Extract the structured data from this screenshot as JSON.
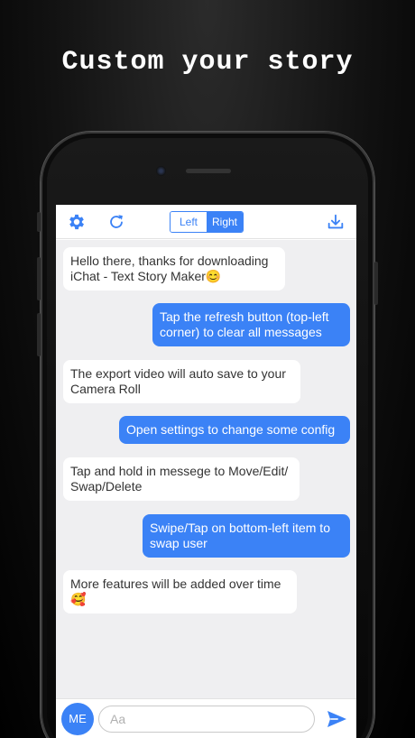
{
  "headline": "Custom your story",
  "toolbar": {
    "settings_icon": "gear-icon",
    "refresh_icon": "refresh-icon",
    "segment": {
      "left_label": "Left",
      "right_label": "Right",
      "selected": "Right"
    },
    "download_icon": "download-icon"
  },
  "messages": [
    {
      "side": "left",
      "text": "Hello there, thanks for downloading iChat - Text Story Maker😊"
    },
    {
      "side": "right",
      "text": "Tap the refresh button (top-left corner) to clear all messages"
    },
    {
      "side": "left",
      "text": "The export video will auto save to your Camera Roll"
    },
    {
      "side": "right",
      "text": "Open settings to change some config"
    },
    {
      "side": "left",
      "text": "Tap and hold in messege to Move/Edit/ Swap/Delete"
    },
    {
      "side": "right",
      "text": "Swipe/Tap on bottom-left item to swap user"
    },
    {
      "side": "left",
      "text": "More features will be added over time 🥰"
    }
  ],
  "composer": {
    "user_label": "ME",
    "placeholder": "Aa",
    "send_icon": "send-icon"
  },
  "colors": {
    "accent": "#3b82f6",
    "chat_background": "#efeff1",
    "incoming_bubble": "#ffffff"
  }
}
